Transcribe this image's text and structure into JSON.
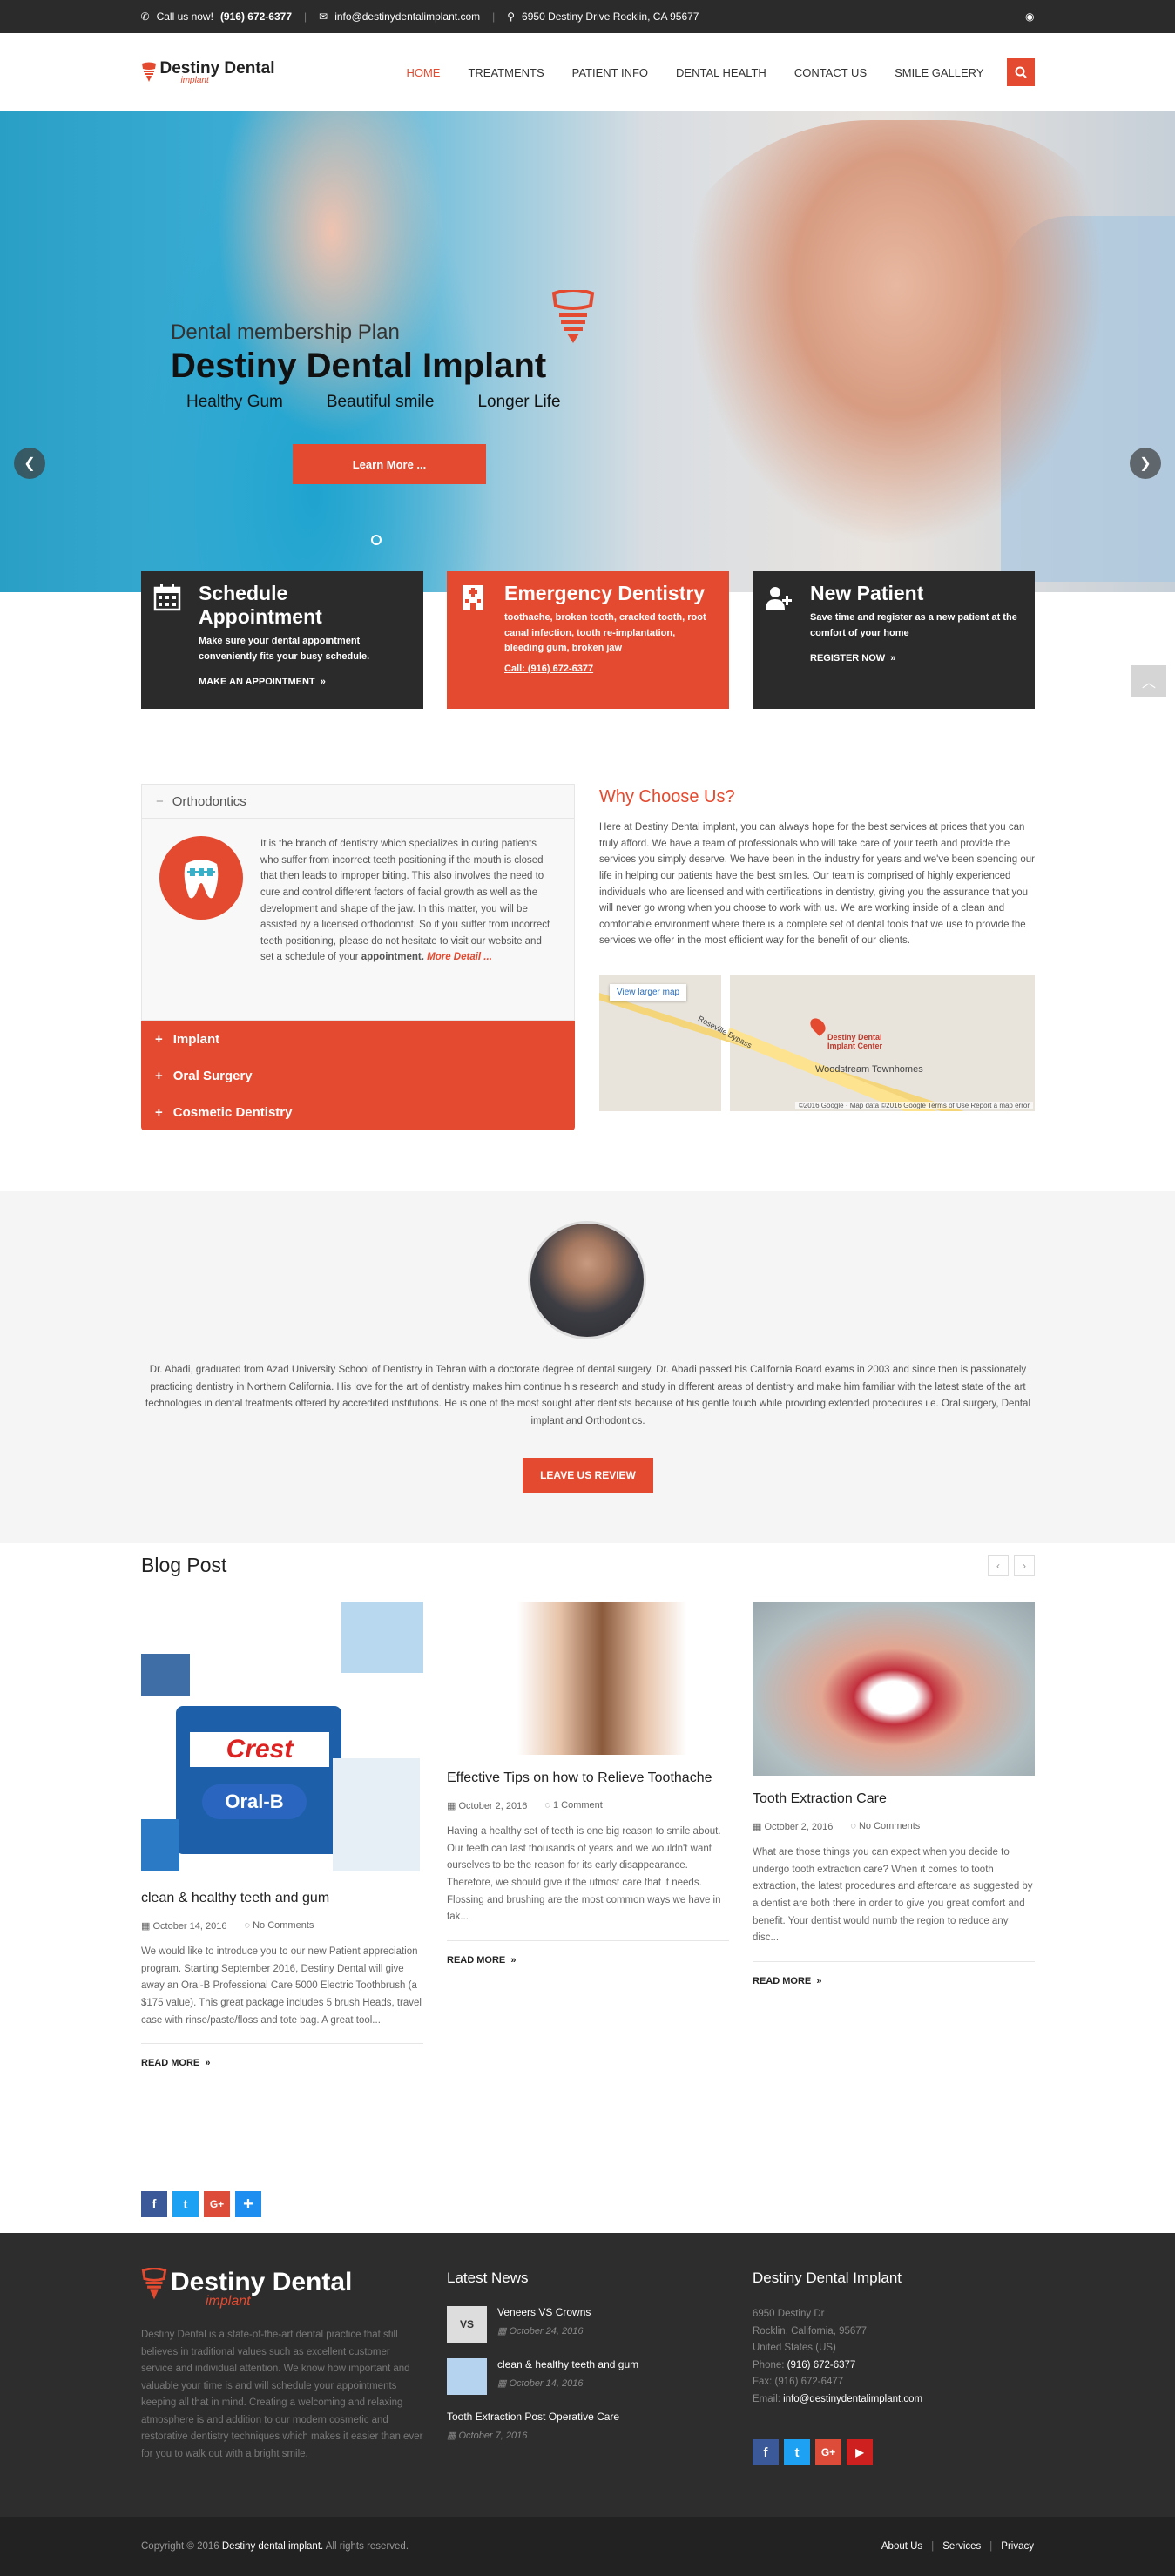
{
  "topbar": {
    "call_label": "Call us now!",
    "phone": "(916) 672-6377",
    "email": "info@destinydentalimplant.com",
    "address": "6950 Destiny Drive Rocklin, CA 95677"
  },
  "header": {
    "logo_name": "Destiny Dental",
    "logo_sub": "implant",
    "nav": [
      "HOME",
      "TREATMENTS",
      "PATIENT INFO",
      "DENTAL HEALTH",
      "CONTACT US",
      "SMILE GALLERY"
    ]
  },
  "hero": {
    "small_title": "Dental membership Plan",
    "big_title": "Destiny Dental Implant",
    "tags": [
      "Healthy Gum",
      "Beautiful smile",
      "Longer Life"
    ],
    "button": "Learn More ..."
  },
  "features": [
    {
      "title": "Schedule Appointment",
      "desc": "Make sure your dental appointment conveniently fits your busy schedule.",
      "link": "MAKE AN APPOINTMENT"
    },
    {
      "title": "Emergency Dentistry",
      "desc": "toothache, broken tooth, cracked tooth, root canal infection, tooth re-implantation, bleeding gum, broken jaw",
      "link": "Call: (916) 672-6377"
    },
    {
      "title": "New Patient",
      "desc": "Save time and register as a new patient at the comfort of your home",
      "link": "REGISTER NOW"
    }
  ],
  "accordion": {
    "open_title": "Orthodontics",
    "open_text": "It is the branch of dentistry which specializes in curing patients who suffer from incorrect teeth positioning if the mouth is closed that then leads to improper biting. This also involves the need to cure and control different factors of facial growth as well as the development and shape of the jaw. In this matter, you will be assisted by a licensed orthodontist. So if you suffer from incorrect teeth positioning, please do not hesitate to visit our website and set a schedule of your ",
    "open_text_bold": "appointment.",
    "more": "More Detail ...",
    "items": [
      "Implant",
      "Oral Surgery",
      "Cosmetic Dentistry"
    ]
  },
  "why": {
    "title": "Why Choose Us?",
    "text": "Here at Destiny Dental implant, you can always hope for the best services at prices that you can truly afford. We have a team of professionals who will take care of your teeth and provide the services you simply deserve. We have been in the industry for years and we've been spending our life in helping our patients have the best smiles. Our team is comprised of highly experienced individuals who are licensed and with certifications in dentistry, giving you the assurance that you will never go wrong when you choose to work with us. We are working inside of a clean and comfortable environment where there is a complete set of dental tools that we use to provide the services we offer in the most efficient way for the benefit of our clients.",
    "map_link": "View larger map",
    "map_pin": "Destiny Dental Implant Center",
    "map_area": "Woodstream Townhomes",
    "map_road": "Roseville Bypass",
    "map_footer": "©2016 Google · Map data ©2016 Google   Terms of Use   Report a map error"
  },
  "doctor": {
    "text": "Dr. Abadi, graduated from Azad University School of Dentistry in Tehran with a doctorate degree of dental surgery. Dr. Abadi passed his California Board exams in 2003 and since then is passionately practicing dentistry in Northern California. His love for the art of dentistry makes him continue his research and study in different areas of dentistry and make him familiar with the latest state of the art technologies in dental treatments offered by accredited institutions. He is one of the most sought after dentists because of his gentle touch while providing extended procedures i.e. Oral surgery, Dental implant and Orthodontics.",
    "button": "LEAVE US REVIEW"
  },
  "blog": {
    "title": "Blog Post",
    "posts": [
      {
        "title": "clean & healthy teeth and gum",
        "date": "October 14, 2016",
        "comments": "No Comments",
        "excerpt": "We would like to introduce you to our new Patient appreciation program. Starting September 2016, Destiny Dental will give away an Oral-B Professional Care 5000 Electric Toothbrush (a $175 value). This great package includes 5 brush Heads, travel case with rinse/paste/floss and tote bag. A great tool...",
        "more": "READ MORE"
      },
      {
        "title": "Effective Tips on how to Relieve Toothache",
        "date": "October 2, 2016",
        "comments": "1 Comment",
        "excerpt": "Having a healthy set of teeth is one big reason to smile about. Our teeth can last thousands of years and we wouldn't want ourselves to be the reason for its early disappearance. Therefore, we should give it the utmost care that it needs. Flossing and brushing are the most common ways we have in tak...",
        "more": "READ MORE"
      },
      {
        "title": "Tooth Extraction Care",
        "date": "October 2, 2016",
        "comments": "No Comments",
        "excerpt": "What are those things you can expect when you decide to undergo tooth extraction care? When it comes to tooth extraction, the latest procedures and aftercare as suggested by a dentist are both there in order to give you great comfort and benefit. Your dentist would numb the region to reduce any disc...",
        "more": "READ MORE"
      }
    ]
  },
  "footer": {
    "logo_name": "Destiny Dental",
    "logo_sub": "implant",
    "desc": "Destiny Dental is a state-of-the-art dental practice that still believes in traditional values such as excellent customer service and individual attention. We know how important and valuable your time is and will schedule your appointments keeping all that in mind. Creating a welcoming and relaxing atmosphere is and addition to our modern cosmetic and restorative dentistry techniques which makes it easier than ever for you to walk out with a bright smile.",
    "news_title": "Latest News",
    "news": [
      {
        "title": "Veneers VS Crowns",
        "date": "October 24, 2016",
        "thumb": "VS"
      },
      {
        "title": "clean & healthy teeth and gum",
        "date": "October 14, 2016",
        "thumb": ""
      },
      {
        "title": "Tooth Extraction Post Operative Care",
        "date": "October 7, 2016",
        "thumb": ""
      }
    ],
    "contact_title": "Destiny Dental Implant",
    "addr1": "6950 Destiny Dr",
    "addr2": "Rocklin, California, 95677",
    "addr3": "United States (US)",
    "phone_label": "Phone:",
    "phone": "(916) 672-6377",
    "fax": "Fax: (916) 672-6477",
    "email_label": "Email:",
    "email": "info@destinydentalimplant.com"
  },
  "bottom": {
    "copy_prefix": "Copyright © 2016",
    "copy_brand": "Destiny dental implant.",
    "copy_suffix": "All rights reserved.",
    "links": [
      "About Us",
      "Services",
      "Privacy"
    ]
  },
  "colors": {
    "accent": "#e44a2f",
    "dark": "#2b2b2b"
  }
}
